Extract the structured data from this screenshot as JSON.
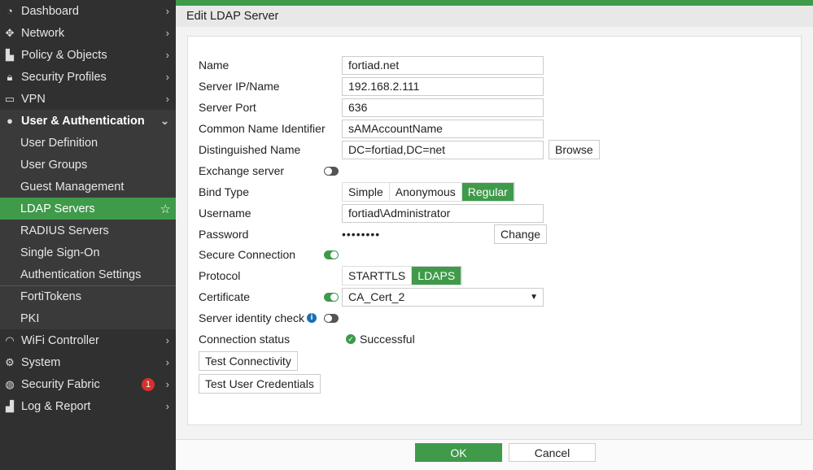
{
  "sidebar": {
    "items": [
      {
        "label": "Dashboard",
        "icon": "dashboard-icon"
      },
      {
        "label": "Network",
        "icon": "network-icon"
      },
      {
        "label": "Policy & Objects",
        "icon": "policy-icon"
      },
      {
        "label": "Security Profiles",
        "icon": "lock-icon"
      },
      {
        "label": "VPN",
        "icon": "laptop-icon"
      },
      {
        "label": "User & Authentication",
        "icon": "user-icon"
      },
      {
        "label": "User Definition"
      },
      {
        "label": "User Groups"
      },
      {
        "label": "Guest Management"
      },
      {
        "label": "LDAP Servers"
      },
      {
        "label": "RADIUS Servers"
      },
      {
        "label": "Single Sign-On"
      },
      {
        "label": "Authentication Settings"
      },
      {
        "label": "FortiTokens"
      },
      {
        "label": "PKI"
      },
      {
        "label": "WiFi Controller",
        "icon": "wifi-icon"
      },
      {
        "label": "System",
        "icon": "gear-icon"
      },
      {
        "label": "Security Fabric",
        "icon": "fabric-icon",
        "badge": "1"
      },
      {
        "label": "Log & Report",
        "icon": "chart-icon"
      }
    ]
  },
  "header": {
    "title": "Edit LDAP Server"
  },
  "form": {
    "name": {
      "label": "Name",
      "value": "fortiad.net"
    },
    "server": {
      "label": "Server IP/Name",
      "value": "192.168.2.111"
    },
    "port": {
      "label": "Server Port",
      "value": "636"
    },
    "cn": {
      "label": "Common Name Identifier",
      "value": "sAMAccountName"
    },
    "dn": {
      "label": "Distinguished Name",
      "value": "DC=fortiad,DC=net",
      "browse": "Browse"
    },
    "exchange": {
      "label": "Exchange server"
    },
    "bind": {
      "label": "Bind Type",
      "options": [
        "Simple",
        "Anonymous",
        "Regular"
      ],
      "selected": "Regular"
    },
    "username": {
      "label": "Username",
      "value": "fortiad\\Administrator"
    },
    "password": {
      "label": "Password",
      "value": "••••••••",
      "change": "Change"
    },
    "secure": {
      "label": "Secure Connection"
    },
    "protocol": {
      "label": "Protocol",
      "options": [
        "STARTTLS",
        "LDAPS"
      ],
      "selected": "LDAPS"
    },
    "certificate": {
      "label": "Certificate",
      "value": "CA_Cert_2"
    },
    "identity": {
      "label": "Server identity check"
    },
    "status": {
      "label": "Connection status",
      "value": "Successful"
    },
    "test_conn": "Test Connectivity",
    "test_user": "Test User Credentials"
  },
  "footer": {
    "ok": "OK",
    "cancel": "Cancel"
  }
}
